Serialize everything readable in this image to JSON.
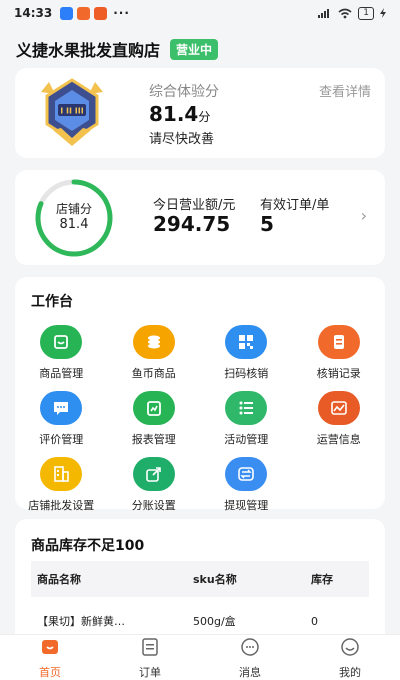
{
  "status_bar": {
    "time": "14:33",
    "more": "···",
    "battery": "1"
  },
  "store": {
    "name": "义捷水果批发直购店",
    "status_badge": "营业中"
  },
  "experience": {
    "label": "综合体验分",
    "score": "81.4",
    "unit": "分",
    "tip": "请尽快改善",
    "link": "查看详情"
  },
  "summary": {
    "shop_score_label": "店铺分",
    "shop_score_value": "81.4",
    "shop_score_fraction": 0.814,
    "revenue_label": "今日营业额/元",
    "revenue_value": "294.75",
    "orders_label": "有效订单/单",
    "orders_value": "5"
  },
  "workbench": {
    "title": "工作台",
    "items": [
      {
        "label": "商品管理",
        "icon": "goods-box-icon",
        "color": "#27b455"
      },
      {
        "label": "鱼币商品",
        "icon": "coin-stack-icon",
        "color": "#f5a400"
      },
      {
        "label": "扫码核销",
        "icon": "scan-grid-icon",
        "color": "#2f8ff0"
      },
      {
        "label": "核销记录",
        "icon": "record-doc-icon",
        "color": "#f26a2b"
      },
      {
        "label": "评价管理",
        "icon": "chat-bubble-icon",
        "color": "#2f8ff0"
      },
      {
        "label": "报表管理",
        "icon": "report-clipboard-icon",
        "color": "#27b455"
      },
      {
        "label": "活动管理",
        "icon": "activity-list-icon",
        "color": "#30b86a"
      },
      {
        "label": "运营信息",
        "icon": "trend-chart-icon",
        "color": "#e85a26"
      },
      {
        "label": "店铺批发设置",
        "icon": "building-icon",
        "color": "#f5b800"
      },
      {
        "label": "分账设置",
        "icon": "share-export-icon",
        "color": "#1fae6a"
      },
      {
        "label": "提现管理",
        "icon": "exchange-icon",
        "color": "#3a8ef2"
      }
    ]
  },
  "stock": {
    "title": "商品库存不足100",
    "columns": [
      "商品名称",
      "sku名称",
      "库存"
    ],
    "rows": [
      [
        "【果切】新鲜黄…",
        "500g/盒",
        "0"
      ]
    ]
  },
  "tabbar": {
    "items": [
      {
        "label": "首页",
        "icon": "home-icon",
        "active": true
      },
      {
        "label": "订单",
        "icon": "order-list-icon",
        "active": false
      },
      {
        "label": "消息",
        "icon": "message-icon",
        "active": false
      },
      {
        "label": "我的",
        "icon": "profile-icon",
        "active": false
      }
    ]
  },
  "colors": {
    "accent_orange": "#f26a2b",
    "green": "#3cbf6a"
  }
}
